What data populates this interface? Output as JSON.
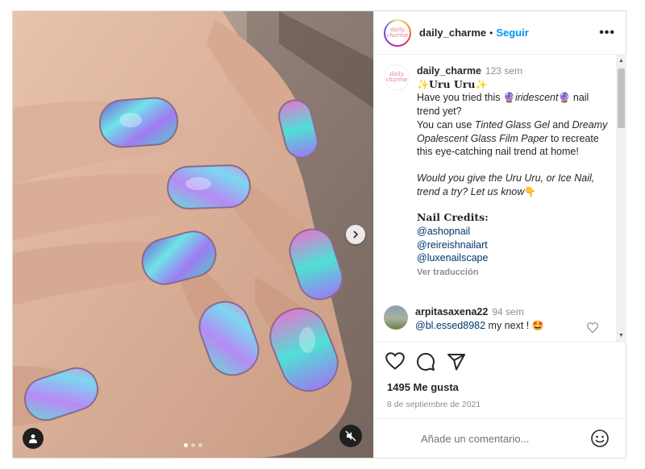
{
  "post": {
    "username": "daily_charme",
    "follow_label": "Seguir",
    "separator": "•",
    "more_label": "•••",
    "logo_line1": "daily",
    "logo_line2": "charme"
  },
  "caption": {
    "username": "daily_charme",
    "time": "123 sem",
    "title_prefix": "✨",
    "title": "Uru Uru",
    "title_suffix": "✨",
    "line1_a": "Have you tried this ",
    "line1_emoji_a": "🔮",
    "line1_b": "iridescent",
    "line1_emoji_b": "🔮",
    "line1_c": " nail trend yet?",
    "line2_a": "You can use ",
    "line2_b": "Tinted Glass Gel",
    "line2_c": " and ",
    "line2_d": "Dreamy Opalescent Glass Film Paper",
    "line2_e": " to recreate this eye-catching nail trend at home!",
    "line3": "Would you give the Uru Uru, or Ice Nail, trend a try? Let us know",
    "line3_emoji": "👇",
    "credits_title": "Nail Credits:",
    "credits": [
      "@ashopnail",
      "@reireishnailart",
      "@luxenailscape"
    ],
    "translate_label": "Ver traducción"
  },
  "comment": {
    "username": "arpitasaxena22",
    "time": "94 sem",
    "mention": "@bl.essed8982",
    "text": " my next ! ",
    "emoji": "🤩"
  },
  "stats": {
    "likes": "1495 Me gusta",
    "date": "8 de septiembre de 2021"
  },
  "composer": {
    "placeholder": "Añade un comentario..."
  },
  "carousel": {
    "slide_count": 3,
    "active_slide": 1
  },
  "icons": [
    "heart-icon",
    "comment-icon",
    "share-icon",
    "emoji-icon",
    "chevron-right-icon",
    "user-icon",
    "mute-icon",
    "more-icon"
  ],
  "colors": {
    "accent": "#0095f6",
    "link": "#00376b",
    "muted": "#8e8e8e"
  }
}
